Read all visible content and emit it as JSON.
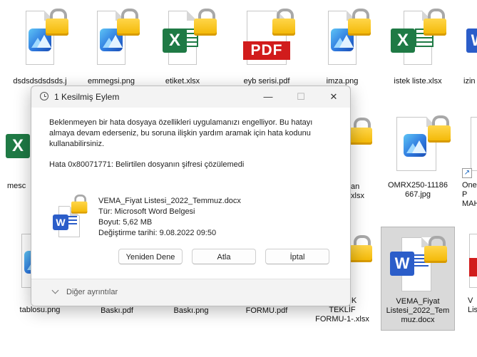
{
  "desktop": {
    "top_labels": [
      "",
      ""
    ],
    "files": [
      {
        "name": "dsdsdsdsdsds.j",
        "kind": "image"
      },
      {
        "name": "emmegsi.png",
        "kind": "image"
      },
      {
        "name": "etiket.xlsx",
        "kind": "excel"
      },
      {
        "name": "eyb serisi.pdf",
        "kind": "pdf"
      },
      {
        "name": "imza.png",
        "kind": "image"
      },
      {
        "name": "istek liste.xlsx",
        "kind": "excel"
      },
      {
        "name": "izin",
        "kind": "word"
      },
      {
        "name": "mesc",
        "kind": "excel"
      },
      {
        "name": "an\nxlsx",
        "kind": "generic"
      },
      {
        "name": "OMRX250-11186\n667.jpg",
        "kind": "image"
      },
      {
        "name": "One\nP\nMAH",
        "kind": "shortcut"
      },
      {
        "name": "va\ntablosu.png",
        "kind": "image"
      },
      {
        "name": "Baskı.pdf",
        "kind": "generic"
      },
      {
        "name": "Baskı.png",
        "kind": "generic"
      },
      {
        "name": "FORMU.pdf",
        "kind": "generic"
      },
      {
        "name": "PROLİK\nTEKLİF\nFORMU-1-.xlsx",
        "kind": "excel"
      },
      {
        "name": "VEMA_Fiyat\nListesi_2022_Tem\nmuz.docx",
        "kind": "word"
      },
      {
        "name": "V\nList",
        "kind": "pdf"
      }
    ]
  },
  "dialog": {
    "title": "1 Kesilmiş Eylem",
    "minimize": "—",
    "maximize": "☐",
    "close": "✕",
    "message": "Beklenmeyen bir hata dosyaya özellikleri uygulamanızı engelliyor. Bu hatayı almaya devam ederseniz, bu soruna ilişkin yardım aramak için hata kodunu kullanabilirsiniz.",
    "error": "Hata 0x80071771: Belirtilen dosyanın şifresi çözülemedi",
    "file": {
      "name": "VEMA_Fiyat Listesi_2022_Temmuz.docx",
      "type": "Tür: Microsoft Word Belgesi",
      "size": "Boyut: 5,62 MB",
      "modified": "Değiştirme tarihi: 9.08.2022 09:50"
    },
    "buttons": {
      "retry": "Yeniden Dene",
      "skip": "Atla",
      "cancel": "İptal"
    },
    "more_details": "Diğer ayrıntılar"
  },
  "colors": {
    "excel": "#1f7a45",
    "word": "#2b5dc9",
    "pdf": "#d11c1c",
    "lock": "#f2b600"
  }
}
